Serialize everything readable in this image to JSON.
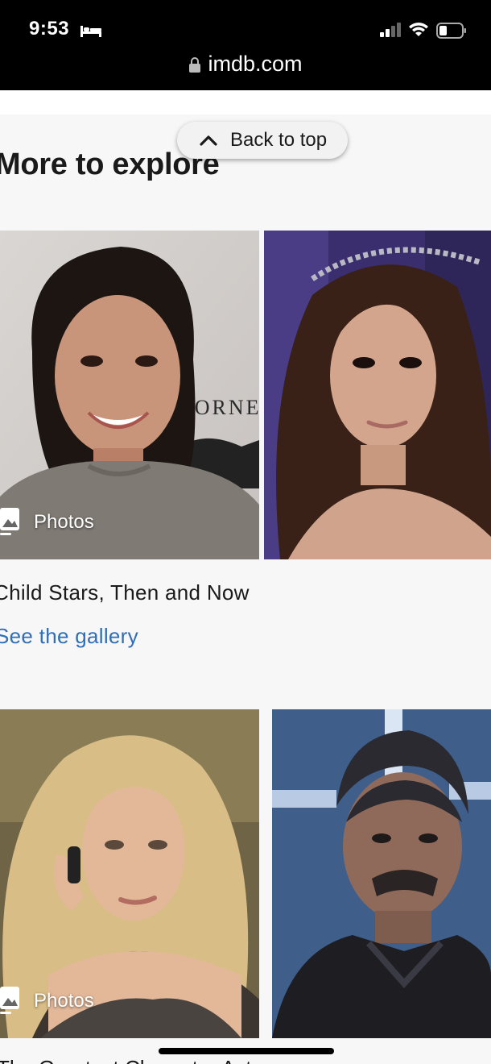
{
  "status_bar": {
    "time": "9:53",
    "icons": [
      "bed-icon",
      "cellular-signal-icon",
      "wifi-icon",
      "battery-icon"
    ]
  },
  "url_bar": {
    "lock_icon": "lock-icon",
    "url": "imdb.com"
  },
  "back_to_top": {
    "icon": "chevron-up-icon",
    "label": "Back to top"
  },
  "section": {
    "title": "More to explore"
  },
  "cards": [
    {
      "badge_icon": "photos-icon",
      "badge_label": "Photos",
      "caption": "Child Stars, Then and Now",
      "link": "See the gallery",
      "image_text": "HORNE"
    },
    {
      "badge_icon": "photos-icon",
      "badge_label": "Photos"
    }
  ],
  "bottom_peek_text": "The Greatest Character Actors",
  "colors": {
    "link": "#2f6fb7",
    "background": "#f7f7f7",
    "status_bar": "#000000"
  }
}
